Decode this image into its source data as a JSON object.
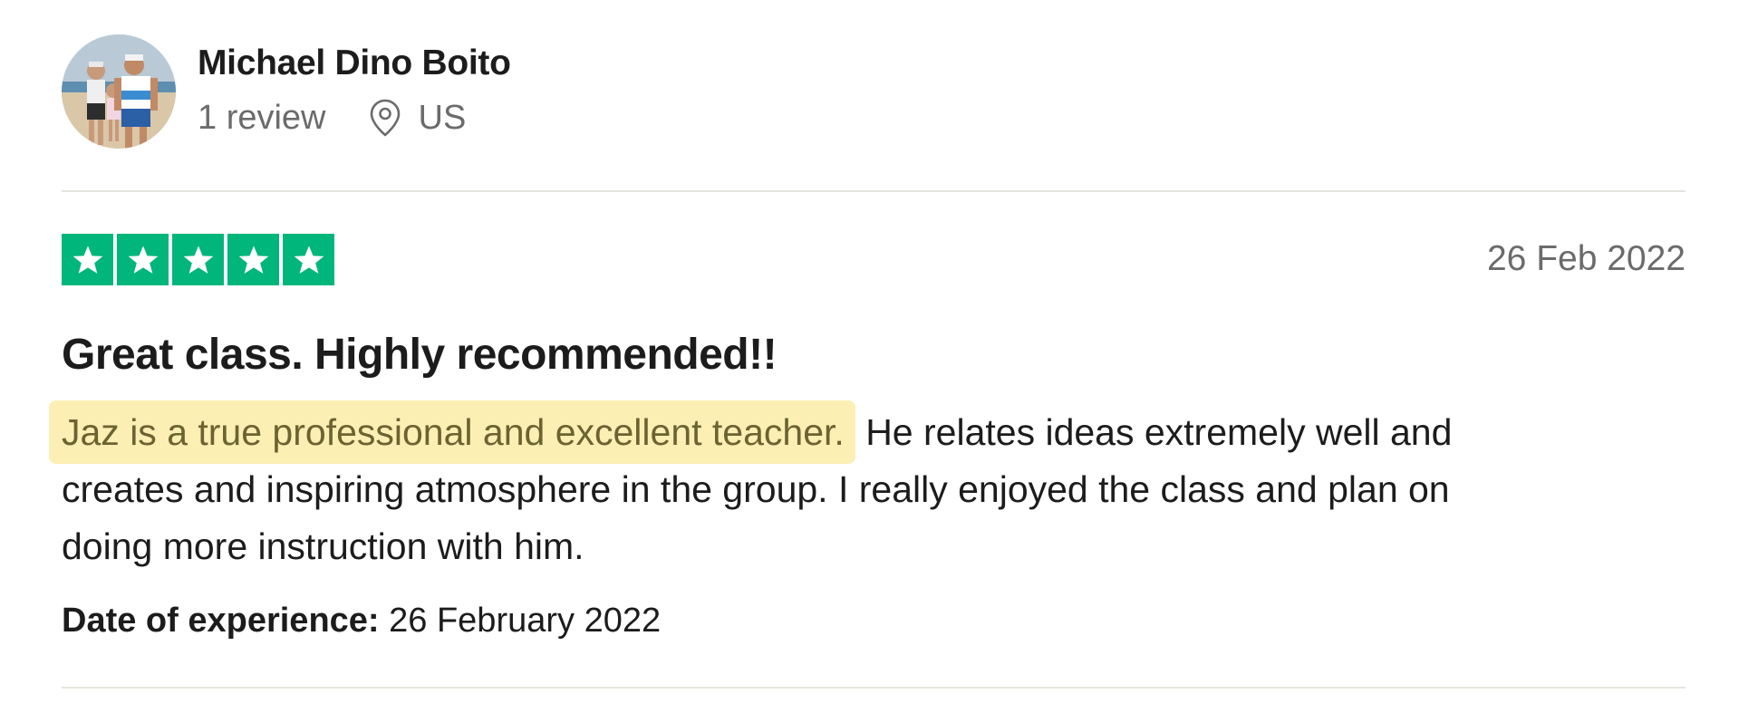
{
  "consumer": {
    "name": "Michael Dino Boito",
    "review_count": "1 review",
    "country": "US",
    "avatar_icon": "profile-photo"
  },
  "review": {
    "rating": 5,
    "rating_max": 5,
    "star_color": "#00b67a",
    "date": "26 Feb 2022",
    "title": "Great class. Highly recommended!!",
    "highlighted_text": "Jaz is a true professional and excellent teacher.",
    "highlight_color": "#fcefb4",
    "body_line1_rest": "He relates ideas extremely well and",
    "body_line2": "creates and inspiring atmosphere in the group. I really enjoyed the class and plan on",
    "body_line3": "doing more instruction with him.",
    "experience_label": "Date of experience:",
    "experience_date": "26 February 2022"
  }
}
